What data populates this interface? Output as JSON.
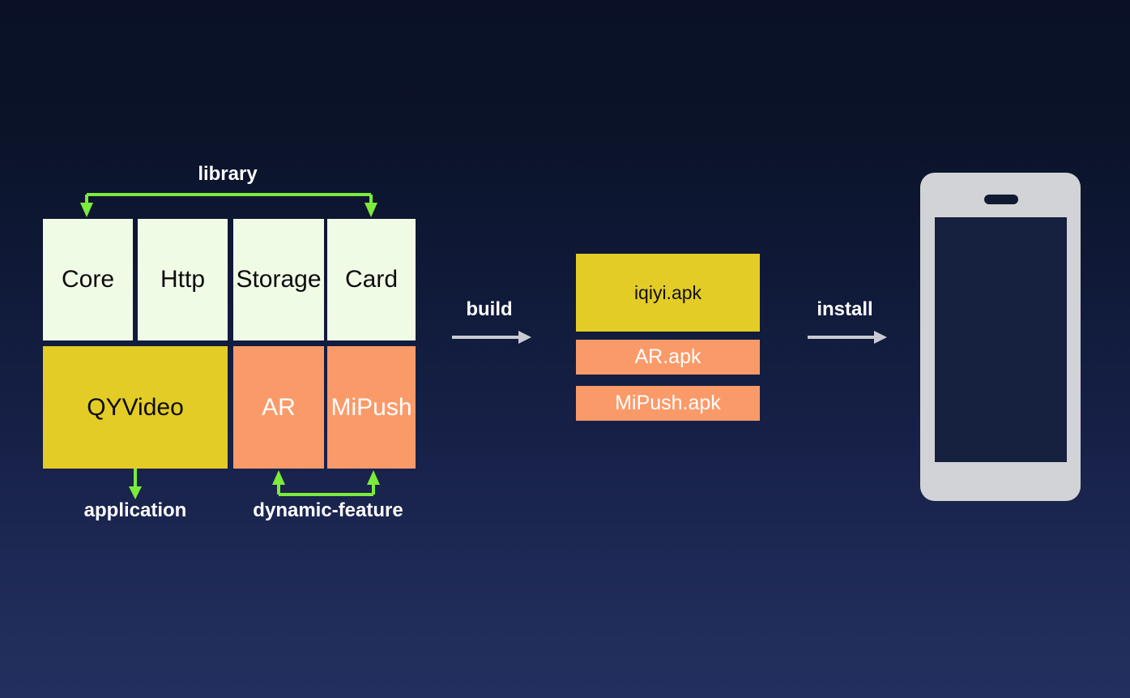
{
  "theme": {
    "background_top": "#0a1127",
    "background_bottom": "#23305f",
    "library_box_color": "#f0fbe6",
    "application_color": "#e3cc26",
    "dynamic_feature_color": "#fb9a69",
    "connector_green": "#7ceb3c",
    "process_arrow_gray": "#c9cbd3",
    "phone_body_color": "#d2d3d6",
    "phone_screen_color": "#16203f"
  },
  "diagram": {
    "library_label": "library",
    "application_label": "application",
    "dynamic_feature_label": "dynamic-feature",
    "library_modules": [
      {
        "name": "Core"
      },
      {
        "name": "Http"
      },
      {
        "name": "Storage"
      },
      {
        "name": "Card"
      }
    ],
    "module_row2": [
      {
        "name": "QYVideo",
        "kind": "application"
      },
      {
        "name": "AR",
        "kind": "dynamic-feature"
      },
      {
        "name": "MiPush",
        "kind": "dynamic-feature"
      }
    ],
    "build_label": "build",
    "install_label": "install",
    "artifacts": [
      {
        "name": "iqiyi.apk",
        "kind": "application"
      },
      {
        "name": "AR.apk",
        "kind": "dynamic-feature"
      },
      {
        "name": "MiPush.apk",
        "kind": "dynamic-feature"
      }
    ],
    "device": {
      "name": "phone",
      "screen_content": ""
    }
  }
}
